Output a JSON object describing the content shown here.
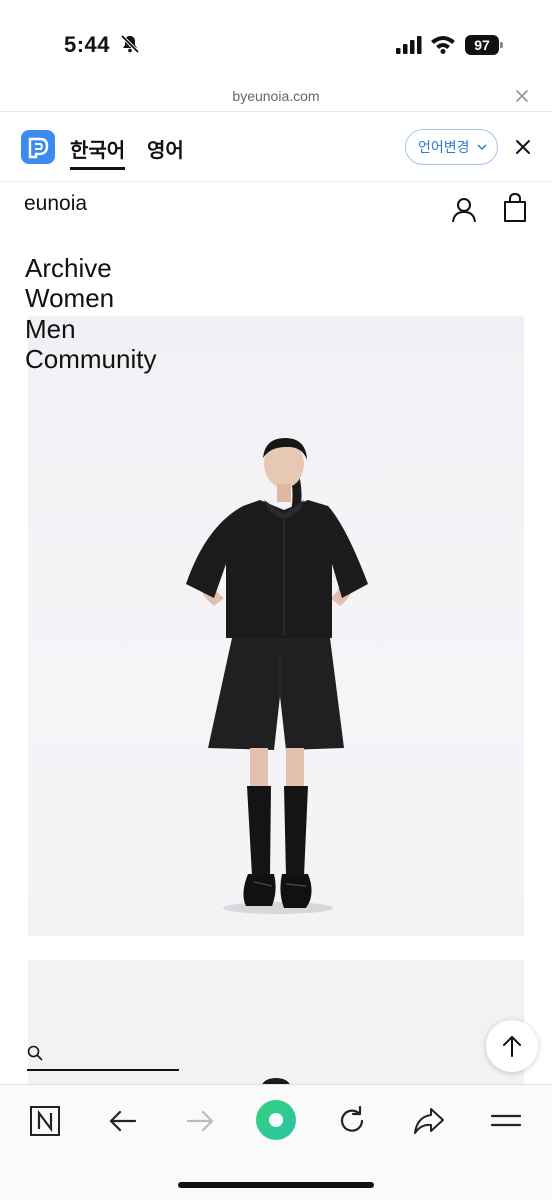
{
  "status_bar": {
    "time": "5:44",
    "battery": "97"
  },
  "browser": {
    "url": "byeunoia.com"
  },
  "translate_bar": {
    "tabs": [
      {
        "label": "한국어",
        "active": true
      },
      {
        "label": "영어",
        "active": false
      }
    ],
    "change_language_label": "언어변경"
  },
  "site": {
    "logo": "eunoia",
    "nav": [
      "Archive",
      "Women",
      "Men",
      "Community"
    ]
  },
  "colors": {
    "papago_blue": "#3c8bf0",
    "accent_blue": "#2d7bd2",
    "green_button": "#3ddc6a"
  }
}
